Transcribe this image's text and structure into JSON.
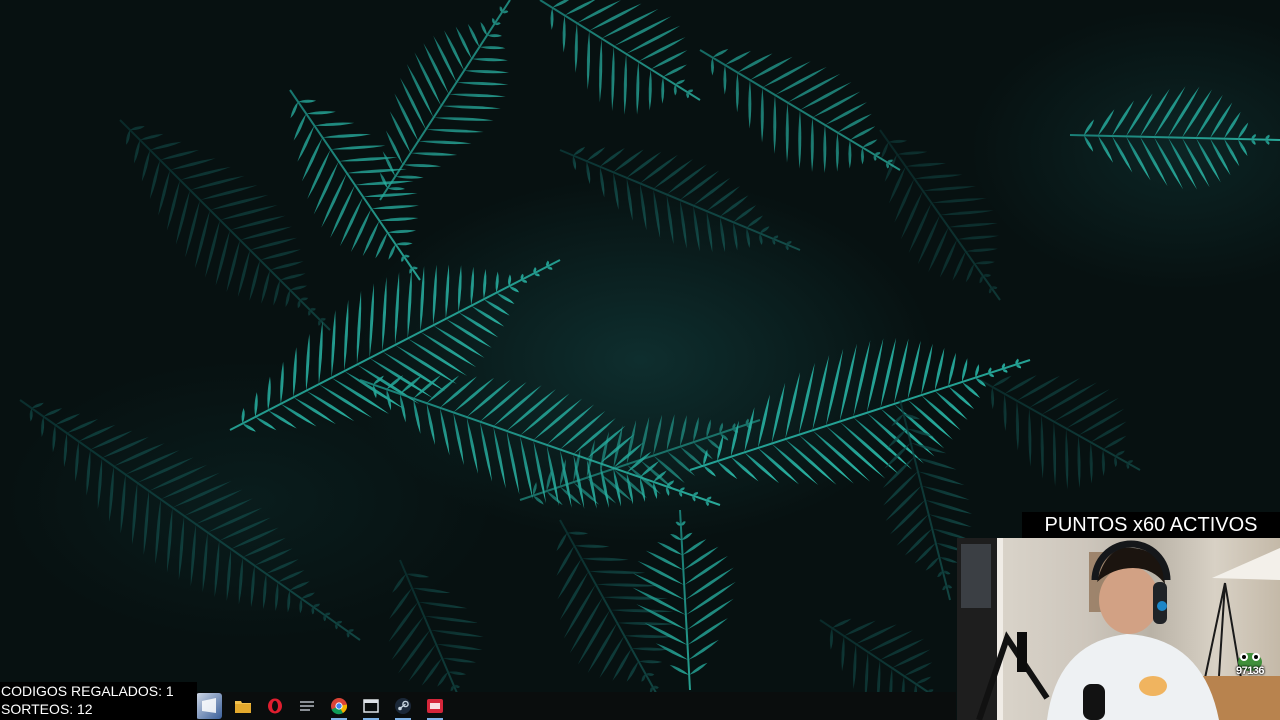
{
  "wallpaper": {
    "subject": "fern-leaves",
    "accent_color": "#2fb3a3"
  },
  "taskbar": {
    "items": [
      {
        "name": "start-button",
        "icon": "windows-logo"
      },
      {
        "name": "file-explorer",
        "icon": "folder-icon"
      },
      {
        "name": "opera",
        "icon": "opera-icon"
      },
      {
        "name": "app-launcher",
        "icon": "app-icon"
      },
      {
        "name": "chrome",
        "icon": "chrome-icon"
      },
      {
        "name": "window-app",
        "icon": "window-icon"
      },
      {
        "name": "steam",
        "icon": "steam-icon"
      },
      {
        "name": "game-app",
        "icon": "game-icon"
      }
    ]
  },
  "overlay": {
    "codes_label": "CODIGOS REGALADOS: 1",
    "draws_label": "SORTEOS: 12",
    "points_banner": "PUNTOS x60 ACTIVOS",
    "emote_count": "97136"
  },
  "webcam": {
    "description_icon": "webcam-feed"
  }
}
